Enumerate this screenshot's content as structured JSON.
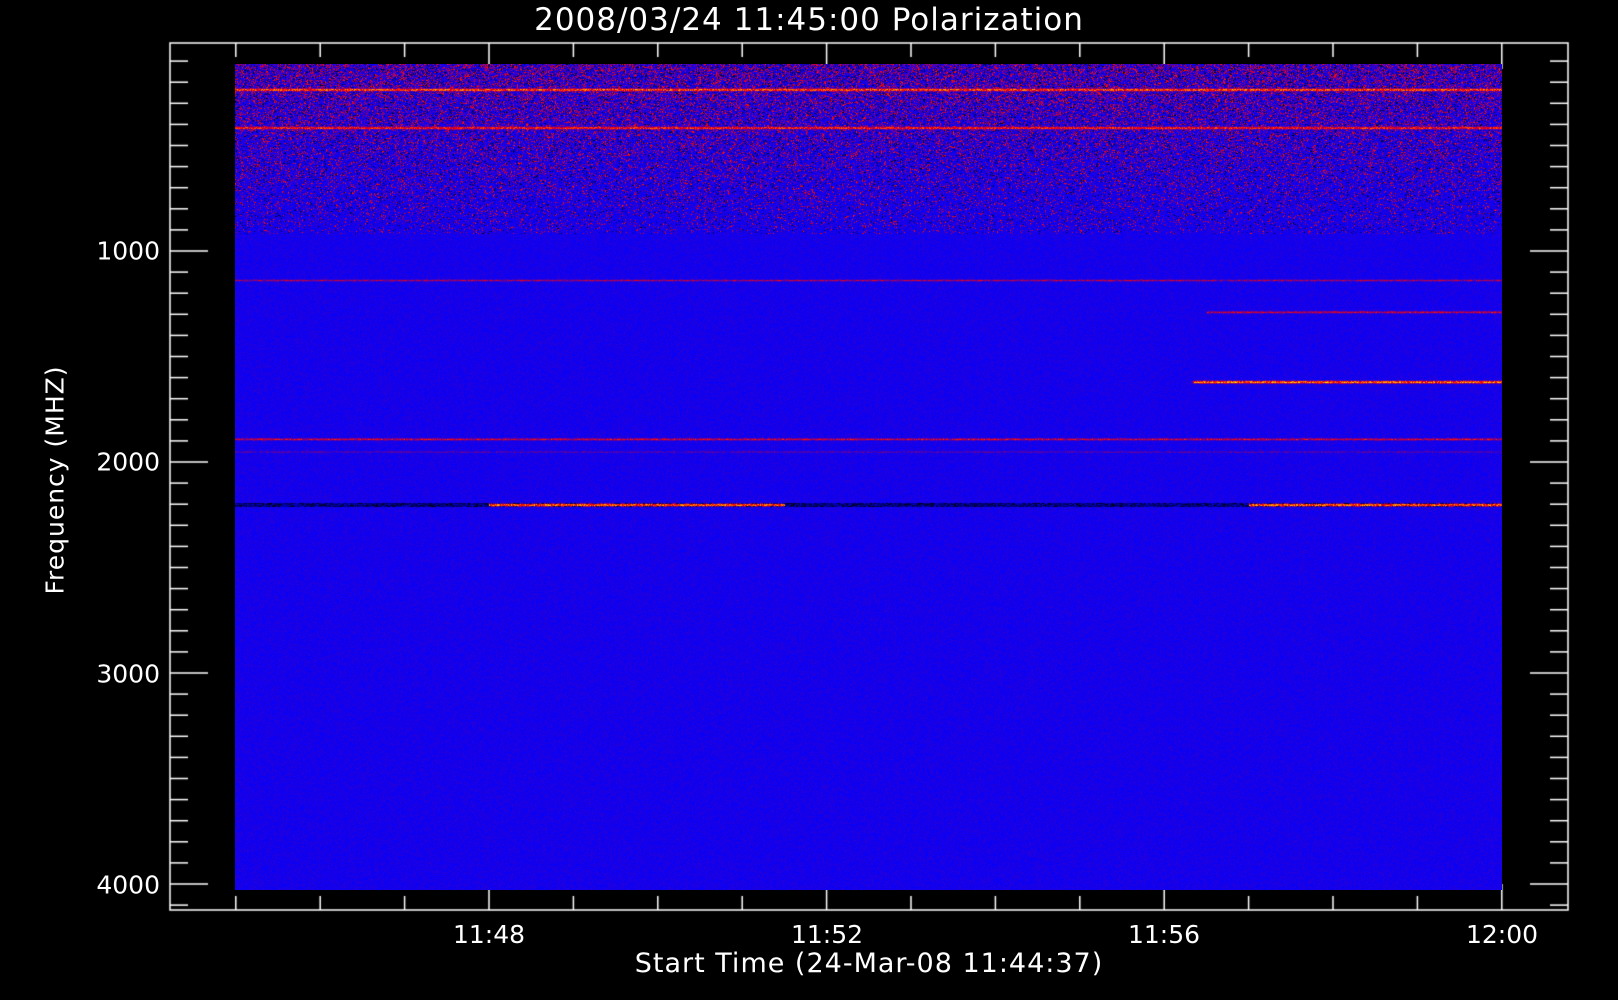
{
  "chart_data": {
    "type": "heatmap",
    "title": "2008/03/24 11:45:00 Polarization",
    "xlabel": "Start Time (24-Mar-08 11:44:37)",
    "ylabel": "Frequency (MHZ)",
    "x_ticks": [
      "11:48",
      "11:52",
      "11:56",
      "12:00"
    ],
    "y_ticks": [
      "1000",
      "2000",
      "3000",
      "4000"
    ],
    "x_range_minutes": [
      "11:45",
      "12:00"
    ],
    "y_range_mhz": [
      100,
      4000
    ],
    "y_axis_reversed": true,
    "colormap": [
      "#000000",
      "#0000ff",
      "#800080",
      "#ff0000",
      "#ff8000",
      "#ffff00",
      "#ffffff"
    ],
    "features": [
      {
        "desc": "noisy high-polarization region",
        "freq_range": [
          100,
          900
        ],
        "time_range": [
          "11:45",
          "12:00"
        ],
        "intensity": 0.6
      },
      {
        "desc": "bright band",
        "freq": 220,
        "time_range": [
          "11:45",
          "12:00"
        ],
        "intensity": 0.9
      },
      {
        "desc": "bright band",
        "freq": 400,
        "time_range": [
          "11:45",
          "12:00"
        ],
        "intensity": 0.8
      },
      {
        "desc": "band",
        "freq": 1120,
        "time_range": [
          "11:45",
          "12:00"
        ],
        "intensity": 0.5
      },
      {
        "desc": "emission band",
        "freq": 1270,
        "time_range": [
          "11:56:30",
          "12:00"
        ],
        "intensity": 0.6
      },
      {
        "desc": "emission band",
        "freq": 1600,
        "time_range": [
          "11:56:20",
          "12:00"
        ],
        "intensity": 0.95
      },
      {
        "desc": "band",
        "freq": 1870,
        "time_range": [
          "11:45",
          "12:00"
        ],
        "intensity": 0.6
      },
      {
        "desc": "band",
        "freq": 1930,
        "time_range": [
          "11:45",
          "12:00"
        ],
        "intensity": 0.4
      },
      {
        "desc": "bright band",
        "freq": 2180,
        "time_range": [
          "11:48",
          "11:51:30"
        ],
        "intensity": 0.95
      },
      {
        "desc": "bright band",
        "freq": 2180,
        "time_range": [
          "11:57",
          "12:00"
        ],
        "intensity": 0.95
      }
    ]
  }
}
